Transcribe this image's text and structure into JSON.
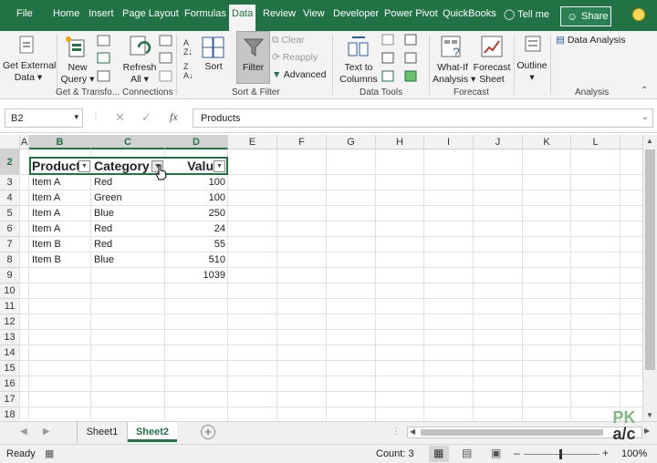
{
  "tabs": [
    "File",
    "Home",
    "Insert",
    "Page Layout",
    "Formulas",
    "Data",
    "Review",
    "View",
    "Developer",
    "Power Pivot",
    "QuickBooks",
    "Tell me",
    "Share"
  ],
  "ribbon": {
    "get_external_data": "Get External",
    "get_external_data2": "Data",
    "new_query": "New",
    "new_query2": "Query",
    "refresh_all": "Refresh",
    "refresh_all2": "All",
    "sort": "Sort",
    "filter": "Filter",
    "clear": "Clear",
    "reapply": "Reapply",
    "advanced": "Advanced",
    "text_to_columns": "Text to",
    "text_to_columns2": "Columns",
    "what_if": "What-If",
    "what_if2": "Analysis",
    "forecast_sheet": "Forecast",
    "forecast_sheet2": "Sheet",
    "outline": "Outline",
    "data_analysis": "Data Analysis",
    "groups": [
      "Get & Transfo...",
      "Connections",
      "Sort & Filter",
      "Data Tools",
      "Forecast",
      "Analysis"
    ]
  },
  "formula_bar": {
    "name_box": "B2",
    "fx": "fx",
    "value": "Products"
  },
  "columns": [
    "A",
    "B",
    "C",
    "D",
    "E",
    "F",
    "G",
    "H",
    "I",
    "J",
    "K",
    "L"
  ],
  "rows": [
    "2",
    "3",
    "4",
    "5",
    "6",
    "7",
    "8",
    "9",
    "10",
    "11",
    "12",
    "13",
    "14",
    "15",
    "16",
    "17",
    "18"
  ],
  "table": {
    "headers": [
      "Product",
      "Category",
      "Valu"
    ],
    "rows": [
      [
        "Item A",
        "Red",
        "100"
      ],
      [
        "Item A",
        "Green",
        "100"
      ],
      [
        "Item A",
        "Blue",
        "250"
      ],
      [
        "Item A",
        "Red",
        "24"
      ],
      [
        "Item B",
        "Red",
        "55"
      ],
      [
        "Item B",
        "Blue",
        "510"
      ],
      [
        "",
        "",
        "1039"
      ]
    ]
  },
  "sheets": [
    "Sheet1",
    "Sheet2"
  ],
  "status": {
    "ready": "Ready",
    "count": "Count: 3",
    "zoom": "100%"
  },
  "watermark": [
    "PK",
    "a/c"
  ]
}
